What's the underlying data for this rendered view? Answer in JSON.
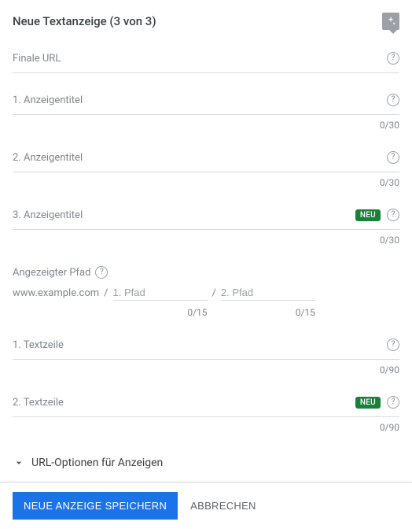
{
  "header": {
    "title": "Neue Textanzeige (3 von 3)"
  },
  "finalUrl": {
    "label": "Finale URL"
  },
  "headline1": {
    "label": "1. Anzeigentitel",
    "counter": "0/30"
  },
  "headline2": {
    "label": "2. Anzeigentitel",
    "counter": "0/30"
  },
  "headline3": {
    "label": "3. Anzeigentitel",
    "counter": "0/30",
    "badge": "NEU"
  },
  "path": {
    "label": "Angezeigter Pfad",
    "base": "www.example.com",
    "sep": "/",
    "p1": {
      "placeholder": "1. Pfad",
      "counter": "0/15"
    },
    "p2": {
      "placeholder": "2. Pfad",
      "counter": "0/15"
    }
  },
  "desc1": {
    "label": "1. Textzeile",
    "counter": "0/90"
  },
  "desc2": {
    "label": "2. Textzeile",
    "counter": "0/90",
    "badge": "NEU"
  },
  "urlOptions": {
    "label": "URL-Optionen für Anzeigen"
  },
  "footer": {
    "save": "NEUE ANZEIGE SPEICHERN",
    "cancel": "ABBRECHEN"
  }
}
